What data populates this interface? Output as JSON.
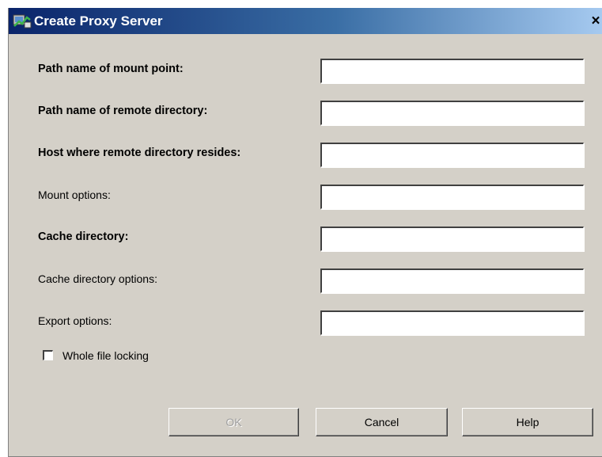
{
  "window": {
    "title": "Create Proxy Server",
    "icon": "proxy-server-app-icon",
    "close_glyph": "×"
  },
  "form": {
    "fields": [
      {
        "label": "Path name of mount point:",
        "value": "",
        "required": true
      },
      {
        "label": "Path name of remote directory:",
        "value": "",
        "required": true
      },
      {
        "label": "Host where remote directory resides:",
        "value": "",
        "required": true
      },
      {
        "label": "Mount options:",
        "value": "",
        "required": false
      },
      {
        "label": "Cache directory:",
        "value": "",
        "required": true
      },
      {
        "label": "Cache directory options:",
        "value": "",
        "required": false
      },
      {
        "label": "Export options:",
        "value": "",
        "required": false
      }
    ],
    "checkbox": {
      "label": "Whole file locking",
      "checked": false
    }
  },
  "buttons": {
    "ok_label": "OK",
    "cancel_label": "Cancel",
    "help_label": "Help",
    "ok_enabled": false
  },
  "colors": {
    "dialog_bg": "#d4d0c8",
    "titlebar_start": "#0a246a",
    "titlebar_end": "#a6caf0",
    "disabled_text": "#a0a0a0"
  }
}
